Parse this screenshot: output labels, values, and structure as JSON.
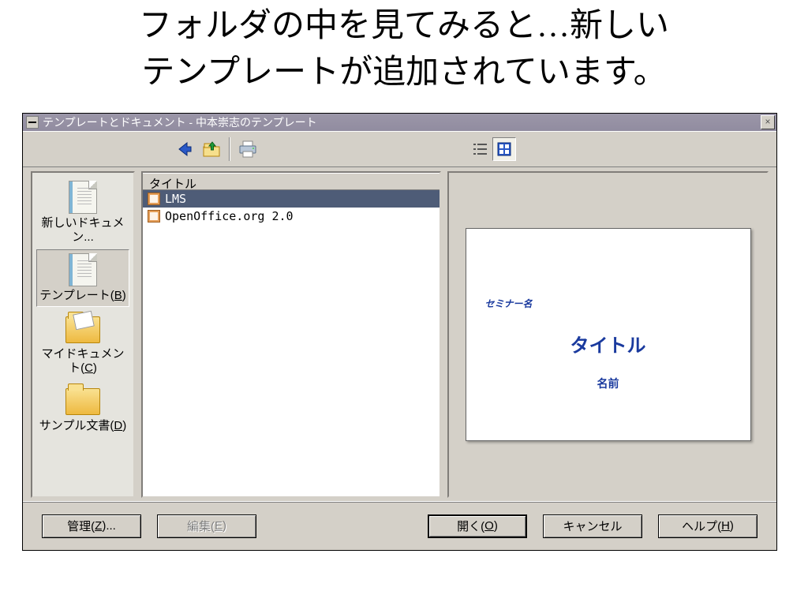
{
  "slide": {
    "title_line1": "フォルダの中を見てみると…新しい",
    "title_line2": "テンプレートが追加されています。"
  },
  "window": {
    "title": "テンプレートとドキュメント - 中本崇志のテンプレート"
  },
  "sidebar": {
    "items": [
      {
        "label_pre": "新しいドキュメン...",
        "key": ""
      },
      {
        "label_pre": "テンプレート(",
        "key": "B",
        "label_post": ")"
      },
      {
        "label_pre": "マイドキュメント(",
        "key": "C",
        "label_post": ")"
      },
      {
        "label_pre": "サンプル文書(",
        "key": "D",
        "label_post": ")"
      }
    ]
  },
  "list": {
    "header": "タイトル",
    "items": [
      {
        "name": "LMS"
      },
      {
        "name": "OpenOffice.org 2.0"
      }
    ]
  },
  "preview": {
    "seminar": "セミナー名",
    "title": "タイトル",
    "name": "名前"
  },
  "buttons": {
    "manage_pre": "管理(",
    "manage_key": "Z",
    "manage_post": ")...",
    "edit_pre": "編集(",
    "edit_key": "E",
    "edit_post": ")",
    "open_pre": "開く(",
    "open_key": "O",
    "open_post": ")",
    "cancel": "キャンセル",
    "help_pre": "ヘルプ(",
    "help_key": "H",
    "help_post": ")"
  }
}
